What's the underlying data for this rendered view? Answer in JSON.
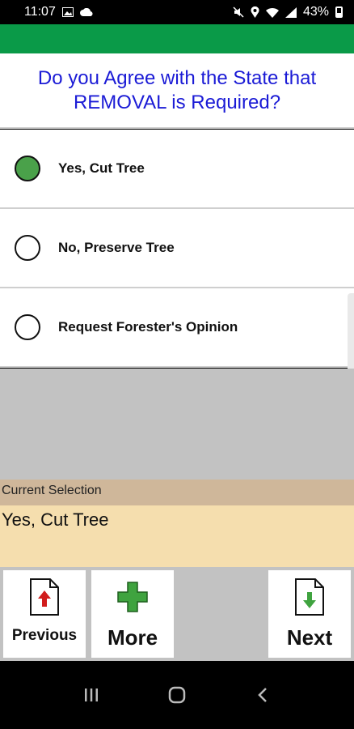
{
  "status_bar": {
    "time": "11:07",
    "battery": "43%"
  },
  "question": "Do you Agree with the State that REMOVAL is Required?",
  "options": [
    {
      "label": "Yes, Cut Tree",
      "selected": true
    },
    {
      "label": "No, Preserve Tree",
      "selected": false
    },
    {
      "label": "Request Forester's Opinion",
      "selected": false
    }
  ],
  "current_selection": {
    "label": "Current Selection",
    "value": "Yes, Cut Tree"
  },
  "nav": {
    "previous_label": "Previous",
    "more_label": "More",
    "next_label": "Next"
  },
  "colors": {
    "header_green": "#0a9a48",
    "question_blue": "#1b1bd6",
    "radio_selected": "#4aa14a",
    "current_label_bg": "#cfb79a",
    "current_value_bg": "#f5deae",
    "gray_area": "#c2c2c2",
    "arrow_red": "#d11c1c",
    "arrow_green": "#3fa33f"
  },
  "icons": {
    "previous": "document-up-arrow-icon",
    "more": "plus-icon",
    "next": "document-down-arrow-icon"
  }
}
